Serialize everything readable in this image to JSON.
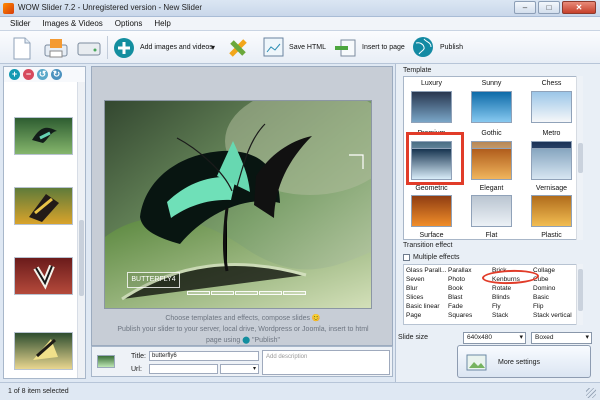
{
  "window": {
    "title": "WOW Slider 7.2 - Unregistered version - New Slider",
    "minimize": "–",
    "maximize": "□",
    "close": "✕"
  },
  "menu": [
    "Slider",
    "Images & Videos",
    "Options",
    "Help"
  ],
  "toolbar": {
    "add_images": "Add images and videos",
    "save_html": "Save HTML",
    "insert_to_page": "Insert to page",
    "publish": "Publish"
  },
  "left": {
    "tool_icons": [
      "add-icon",
      "remove-icon",
      "rotate-left-icon",
      "rotate-right-icon"
    ],
    "thumbnails": [
      {
        "name": "butterfly-thumb-1",
        "colors": [
          "#2e5d31",
          "#85b66c"
        ]
      },
      {
        "name": "butterfly-thumb-2",
        "colors": [
          "#5f7b3a",
          "#d9a32b"
        ]
      },
      {
        "name": "butterfly-thumb-3",
        "colors": [
          "#6b1b1b",
          "#b54a3b"
        ]
      },
      {
        "name": "butterfly-thumb-4",
        "colors": [
          "#2d4d2f",
          "#e8d690"
        ]
      }
    ]
  },
  "preview": {
    "caption": "BUTTERFLY4",
    "hint_line1": "Choose templates and effects, compose slides 😊",
    "hint_line2": "Publish your slider to your server, local drive, Wordpress or Joomla, insert to html",
    "hint_line3_prefix": "page using",
    "hint_publish": "\"Publish\""
  },
  "editor": {
    "title_label": "Title:",
    "title_value": "butterfly6",
    "url_label": "Url:",
    "description_placeholder": "Add description"
  },
  "right": {
    "template_section": "Template",
    "templates": [
      {
        "name": "Luxury",
        "colors": [
          "#28364f",
          "#7aa6c7"
        ]
      },
      {
        "name": "Sunny",
        "colors": [
          "#0d6aa8",
          "#87c9f0"
        ]
      },
      {
        "name": "Chess",
        "colors": [
          "#9cc6e8",
          "#f6f7f9"
        ]
      },
      {
        "name": "Premium",
        "colors": [
          "#4a6d84",
          "#b6d4e5"
        ]
      },
      {
        "name": "Gothic",
        "colors": [
          "#b78754",
          "#f0e0c3"
        ]
      },
      {
        "name": "Metro",
        "colors": [
          "#1a3155",
          "#5f7da6"
        ]
      },
      {
        "name": "Geometric",
        "colors": [
          "#173450",
          "#d8ecf8"
        ]
      },
      {
        "name": "Elegant",
        "colors": [
          "#b05d1c",
          "#f0b55d"
        ]
      },
      {
        "name": "Vernisage",
        "colors": [
          "#87a6c0",
          "#d7e6f2"
        ]
      },
      {
        "name": "Surface",
        "colors": [
          "#8f3d12",
          "#f18e2a"
        ]
      },
      {
        "name": "Flat",
        "colors": [
          "#bac5d1",
          "#ecf1f6"
        ]
      },
      {
        "name": "Plastic",
        "colors": [
          "#b06c1c",
          "#f2bd52"
        ]
      }
    ],
    "transition_section": "Transition effect",
    "multiple_effects": "Multiple effects",
    "effects": [
      [
        "Glass Parall...",
        "Seven",
        "Blur",
        "Slices",
        "Basic linear",
        "Page"
      ],
      [
        "Parallax",
        "Photo",
        "Book",
        "Blast",
        "Fade",
        "Squares"
      ],
      [
        "Brick",
        "Kenburns",
        "Rotate",
        "Blinds",
        "Fly",
        "Stack"
      ],
      [
        "Collage",
        "Cube",
        "Domino",
        "Basic",
        "Flip",
        "Stack vertical"
      ]
    ],
    "slide_size_label": "Slide size",
    "slide_size": "640x480",
    "slide_mode": "Boxed",
    "more_settings": "More settings"
  },
  "status": {
    "selected": "1 of 8 item selected"
  },
  "colors": {
    "highlight": "#e13c29",
    "panel_bg": "#e9eff6",
    "accent_teal": "#138e9f"
  }
}
